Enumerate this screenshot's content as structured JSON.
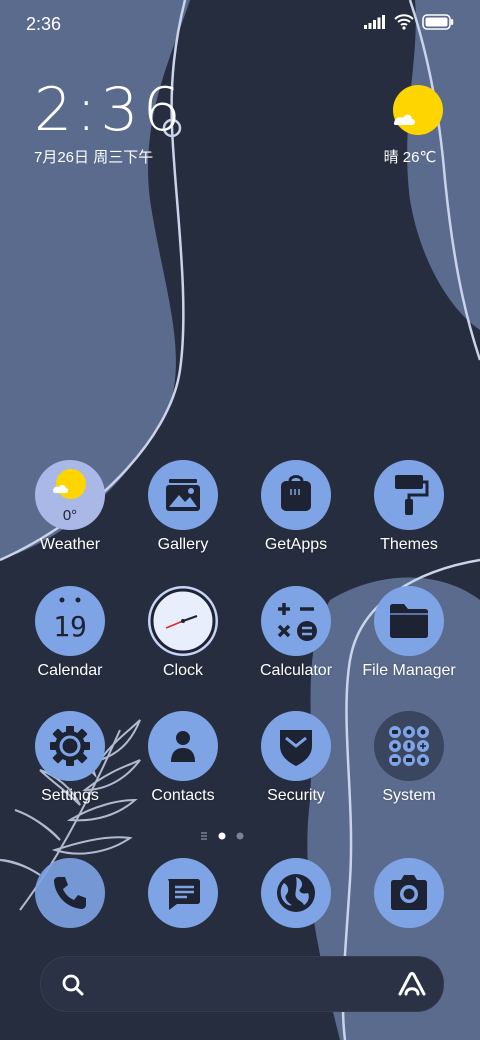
{
  "status_bar": {
    "time": "2:36",
    "icons": [
      "signal-icon",
      "wifi-icon",
      "battery-icon"
    ]
  },
  "clock_widget": {
    "time": "2:36",
    "date": "7月26日 周三下午"
  },
  "weather_widget": {
    "text": "晴 26℃",
    "icon": "sun-icon"
  },
  "apps": [
    {
      "label": "Weather",
      "icon": "weather-icon",
      "badge": "0°"
    },
    {
      "label": "Gallery",
      "icon": "gallery-icon"
    },
    {
      "label": "GetApps",
      "icon": "getapps-icon"
    },
    {
      "label": "Themes",
      "icon": "themes-icon"
    },
    {
      "label": "Calendar",
      "icon": "calendar-icon",
      "badge": "19"
    },
    {
      "label": "Clock",
      "icon": "clock-icon"
    },
    {
      "label": "Calculator",
      "icon": "calculator-icon"
    },
    {
      "label": "File Manager",
      "icon": "folder-icon"
    },
    {
      "label": "Settings",
      "icon": "gear-icon"
    },
    {
      "label": "Contacts",
      "icon": "contacts-icon"
    },
    {
      "label": "Security",
      "icon": "security-icon"
    },
    {
      "label": "System",
      "icon": "system-folder-icon"
    }
  ],
  "dock": [
    {
      "icon": "phone-icon"
    },
    {
      "icon": "messages-icon"
    },
    {
      "icon": "browser-icon"
    },
    {
      "icon": "camera-icon"
    }
  ],
  "page_indicator": {
    "pages": 2,
    "current": 1
  },
  "search_bar": {
    "left_icon": "search-icon",
    "right_icon": "assistant-icon"
  },
  "colors": {
    "background": "#262d3f",
    "wallpaper_shape": "#5b6b8e",
    "icon_fill": "#7ea4e6",
    "icon_glyph": "#1d2333",
    "sun": "#ffd500"
  }
}
